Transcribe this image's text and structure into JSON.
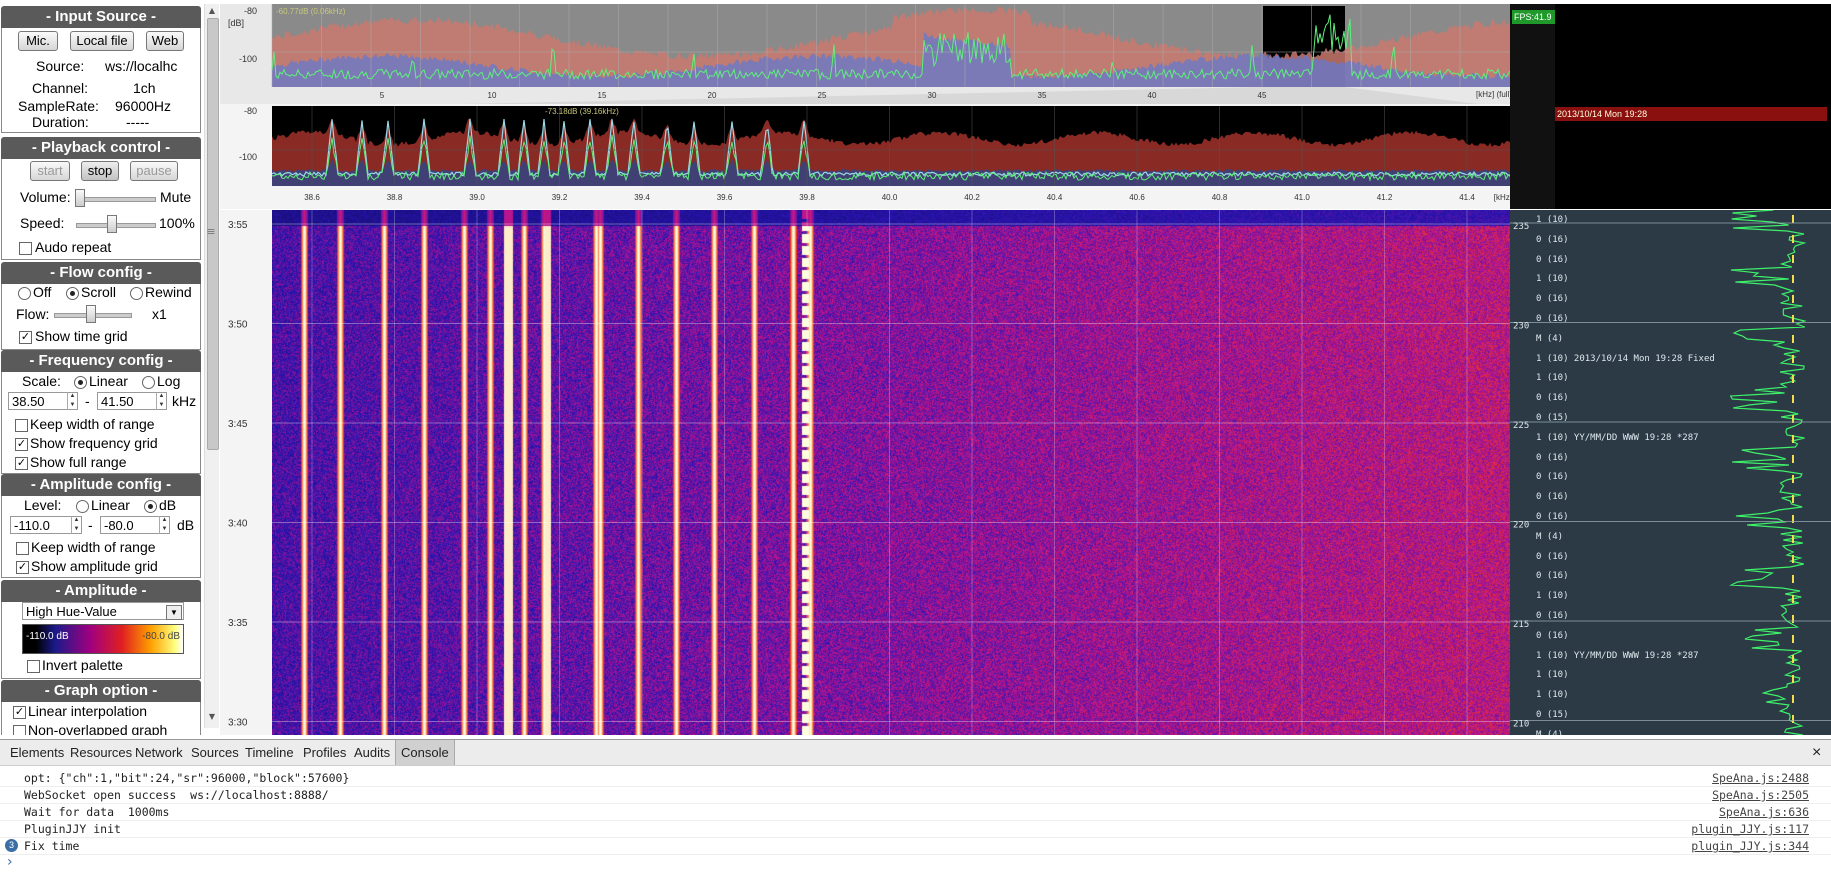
{
  "sidebar": {
    "input_source": {
      "title": "- Input Source -",
      "buttons": [
        "Mic.",
        "Local file",
        "Web"
      ],
      "rows": [
        {
          "label": "Source:",
          "value": "ws://localhc"
        },
        {
          "label": "Channel:",
          "value": "1ch"
        },
        {
          "label": "SampleRate:",
          "value": "96000Hz"
        },
        {
          "label": "Duration:",
          "value": "-----"
        }
      ]
    },
    "playback": {
      "title": "- Playback control -",
      "start": "start",
      "stop": "stop",
      "pause": "pause",
      "volume_label": "Volume:",
      "volume_value": "Mute",
      "speed_label": "Speed:",
      "speed_value": "100%",
      "auto_repeat": "Audo repeat"
    },
    "flow": {
      "title": "- Flow config -",
      "off": "Off",
      "scroll": "Scroll",
      "rewind": "Rewind",
      "flow_label": "Flow:",
      "flow_value": "x1",
      "show_time_grid": "Show time grid"
    },
    "frequency": {
      "title": "- Frequency config -",
      "scale_label": "Scale:",
      "linear": "Linear",
      "log": "Log",
      "min": "38.50",
      "dash": "-",
      "max": "41.50",
      "unit": "kHz",
      "keep_width": "Keep width of range",
      "show_grid": "Show frequency grid",
      "show_full": "Show full range"
    },
    "amplitude_cfg": {
      "title": "- Amplitude config -",
      "level_label": "Level:",
      "linear": "Linear",
      "db": "dB",
      "min": "-110.0",
      "dash": "-",
      "max": "-80.0",
      "unit": "dB",
      "keep_width": "Keep width of range",
      "show_grid": "Show amplitude grid"
    },
    "amplitude": {
      "title": "- Amplitude -",
      "palette": "High Hue-Value",
      "palette_min": "-110.0 dB",
      "palette_max": "-80.0 dB",
      "invert": "Invert palette"
    },
    "graph": {
      "title": "- Graph option -",
      "linear_interp": "Linear interpolation",
      "non_overlapped": "Non-overlapped graph"
    }
  },
  "full_graph": {
    "db_label": "[dB]",
    "y_ticks": [
      "-80",
      "-100"
    ],
    "peak_text": "-60.77dB (0.06kHz)",
    "x_ticks": [
      "5",
      "10",
      "15",
      "20",
      "25",
      "30",
      "35",
      "40",
      "45"
    ],
    "unit": "[kHz] (full)"
  },
  "zoom_graph": {
    "y_ticks": [
      "-80",
      "-100"
    ],
    "peak_text": "-73.18dB (39.16kHz)",
    "x_ticks": [
      "38.6",
      "38.8",
      "39.0",
      "39.2",
      "39.4",
      "39.6",
      "39.8",
      "40.0",
      "40.2",
      "40.4",
      "40.6",
      "40.8",
      "41.0",
      "41.2",
      "41.4"
    ],
    "unit": "[kHz]"
  },
  "waterfall": {
    "time_labels": [
      "3:55",
      "3:50",
      "3:45",
      "3:40",
      "3:35",
      "3:30"
    ]
  },
  "status": {
    "fps": "FPS:41.9",
    "datetime": "2013/10/14 Mon 19:28"
  },
  "decoder": {
    "sec_labels": [
      "235",
      "230",
      "225",
      "220",
      "215",
      "210"
    ],
    "rows": [
      "1 (10)",
      "0 (16)",
      "0 (16)",
      "1 (10)",
      "0 (16)",
      "0 (16)",
      "M (4)",
      "1 (10) 2013/10/14 Mon 19:28 Fixed",
      "1 (10)",
      "0 (16)",
      "0 (15)",
      "1 (10) YY/MM/DD WWW 19:28 *287",
      "0 (16)",
      "0 (16)",
      "0 (16)",
      "0 (16)",
      "M (4)",
      "0 (16)",
      "0 (16)",
      "1 (10)",
      "0 (16)",
      "0 (16)",
      "1 (10) YY/MM/DD WWW 19:28 *287",
      "1 (10)",
      "1 (10)",
      "0 (15)",
      "M (4)"
    ]
  },
  "devtools": {
    "tabs": [
      "Elements",
      "Resources",
      "Network",
      "Sources",
      "Timeline",
      "Profiles",
      "Audits",
      "Console"
    ],
    "active_tab": "Console",
    "close": "×",
    "lines": [
      {
        "text": "opt: {\"ch\":1,\"bit\":24,\"sr\":96000,\"block\":57600}",
        "src": "SpeAna.js:2488"
      },
      {
        "text": "WebSocket open success  ws://localhost:8888/",
        "src": "SpeAna.js:2505"
      },
      {
        "text": "Wait for data  1000ms",
        "src": "SpeAna.js:636"
      },
      {
        "text": "PluginJJY init",
        "src": "plugin_JJY.js:117"
      },
      {
        "text": "Fix time",
        "src": "plugin_JJY.js:344",
        "count": "3"
      }
    ],
    "prompt": "›"
  },
  "colors": {
    "section_header": "#5a5a5a",
    "waterfall_low": "#10106a",
    "waterfall_high": "#ffff66",
    "trace_green": "#5ef07a",
    "fps_green": "#1f9a2a",
    "date_red": "#8a1010"
  }
}
